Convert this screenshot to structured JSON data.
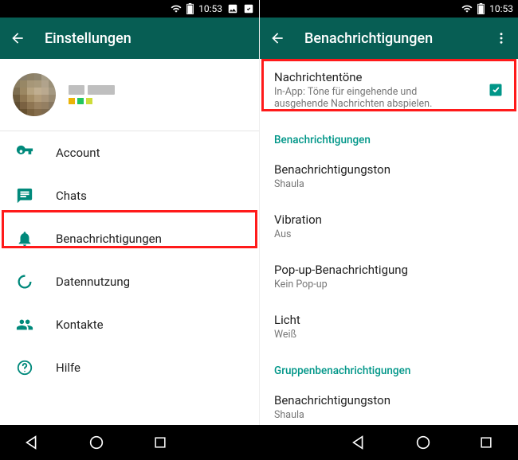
{
  "status": {
    "time": "10:53"
  },
  "left": {
    "title": "Einstellungen",
    "items": [
      {
        "icon": "key-icon",
        "label": "Account"
      },
      {
        "icon": "chat-icon",
        "label": "Chats"
      },
      {
        "icon": "bell-icon",
        "label": "Benachrichtigungen"
      },
      {
        "icon": "data-icon",
        "label": "Datennutzung"
      },
      {
        "icon": "contacts-icon",
        "label": "Kontakte"
      },
      {
        "icon": "help-icon",
        "label": "Hilfe"
      }
    ]
  },
  "right": {
    "title": "Benachrichtigungen",
    "rows": {
      "tones": {
        "title": "Nachrichtentöne",
        "sub": "In-App: Töne für eingehende und ausgehende Nachrichten abspielen.",
        "checked": true
      },
      "section1": "Benachrichtigungen",
      "r1": {
        "title": "Benachrichtigungston",
        "sub": "Shaula"
      },
      "r2": {
        "title": "Vibration",
        "sub": "Aus"
      },
      "r3": {
        "title": "Pop-up-Benachrichtigung",
        "sub": "Kein Pop-up"
      },
      "r4": {
        "title": "Licht",
        "sub": "Weiß"
      },
      "section2": "Gruppenbenachrichtigungen",
      "r5": {
        "title": "Benachrichtigungston",
        "sub": "Shaula"
      }
    }
  }
}
